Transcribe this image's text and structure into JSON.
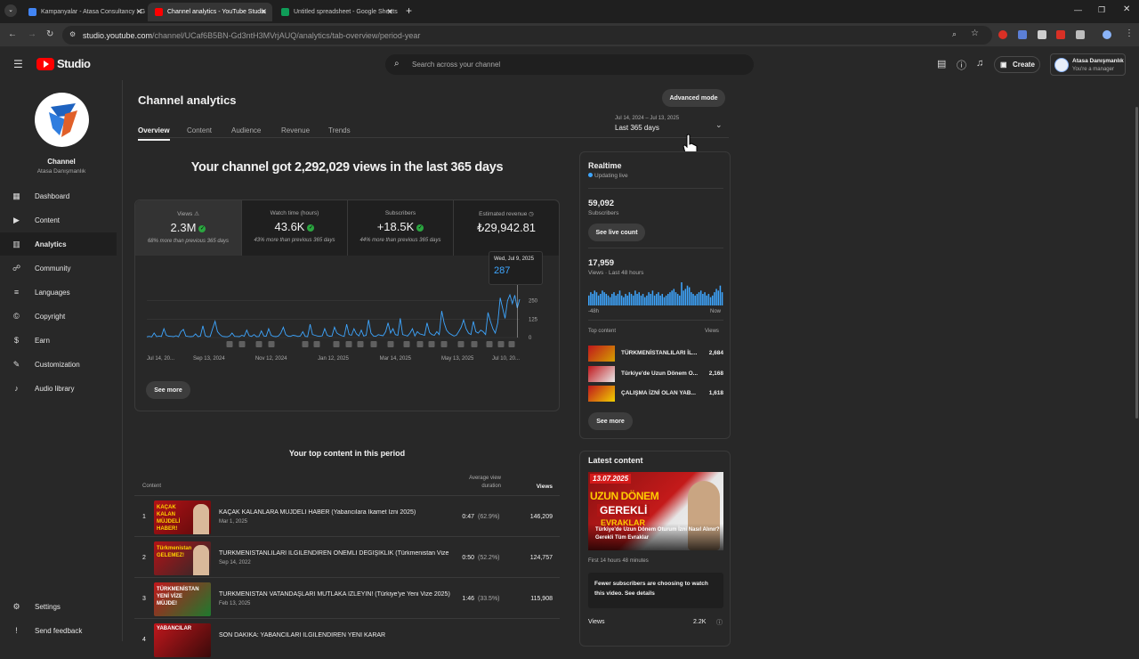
{
  "browser": {
    "tabs": [
      {
        "title": "Kampanyalar - Atasa Consultancy - G",
        "active": false,
        "color": "#4285f4"
      },
      {
        "title": "Channel analytics - YouTube Studio",
        "active": true,
        "color": "#ff0000"
      },
      {
        "title": "Untitled spreadsheet - Google Sheets",
        "active": false,
        "color": "#0f9d58"
      }
    ],
    "url_host": "studio.youtube.com",
    "url_path": "/channel/UCaf6B5BN-Gd3ntH3MVrjAUQ/analytics/tab-overview/period-year"
  },
  "header": {
    "logo_text": "Studio",
    "search_placeholder": "Search across your channel",
    "create_label": "Create",
    "account_name": "Atasa Danışmanlık",
    "account_role": "You're a manager"
  },
  "sidebar": {
    "channel_label": "Channel",
    "channel_name": "Atasa Danışmanlık",
    "items": [
      {
        "label": "Dashboard",
        "icon": "dashboard-icon"
      },
      {
        "label": "Content",
        "icon": "content-icon"
      },
      {
        "label": "Analytics",
        "icon": "analytics-icon",
        "active": true
      },
      {
        "label": "Community",
        "icon": "community-icon"
      },
      {
        "label": "Languages",
        "icon": "languages-icon"
      },
      {
        "label": "Copyright",
        "icon": "copyright-icon"
      },
      {
        "label": "Earn",
        "icon": "earn-icon"
      },
      {
        "label": "Customization",
        "icon": "customization-icon"
      },
      {
        "label": "Audio library",
        "icon": "audio-library-icon"
      }
    ],
    "settings_label": "Settings",
    "feedback_label": "Send feedback"
  },
  "page": {
    "title": "Channel analytics",
    "advanced_mode": "Advanced mode",
    "tabs": [
      "Overview",
      "Content",
      "Audience",
      "Revenue",
      "Trends"
    ],
    "active_tab": "Overview",
    "date_range": "Jul 14, 2024 – Jul 13, 2025",
    "date_preset": "Last 365 days",
    "headline": "Your channel got 2,292,029 views in the last 365 days"
  },
  "metrics": [
    {
      "label": "Views",
      "value": "2.3M",
      "compare": "68% more than previous 365 days"
    },
    {
      "label": "Watch time (hours)",
      "value": "43.6K",
      "compare": "43% more than previous 365 days"
    },
    {
      "label": "Subscribers",
      "value": "+18.5K",
      "compare": "44% more than previous 365 days"
    },
    {
      "label": "Estimated revenue",
      "value": "₺29,942.81",
      "compare": ""
    }
  ],
  "chart_data": {
    "type": "line",
    "x_ticks": [
      "Jul 14, 20...",
      "Sep 13, 2024",
      "Nov 12, 2024",
      "Jan 12, 2025",
      "Mar 14, 2025",
      "May 13, 2025",
      "Jul 10, 20..."
    ],
    "y_ticks": [
      "250",
      "125",
      "0"
    ],
    "ylim": [
      0,
      375
    ],
    "tooltip_date": "Wed, Jul 9, 2025",
    "tooltip_value": "287",
    "values": [
      5,
      8,
      4,
      30,
      6,
      10,
      7,
      60,
      15,
      9,
      8,
      6,
      12,
      5,
      40,
      55,
      10,
      7,
      6,
      8,
      25,
      6,
      9,
      80,
      12,
      5,
      7,
      60,
      110,
      40,
      20,
      8,
      6,
      5,
      10,
      30,
      8,
      7,
      6,
      15,
      9,
      50,
      12,
      8,
      20,
      6,
      7,
      45,
      10,
      9,
      60,
      15,
      8,
      6,
      10,
      30,
      70,
      20,
      9,
      8,
      15,
      12,
      7,
      10,
      40,
      8,
      6,
      90,
      20,
      15,
      10,
      8,
      12,
      60,
      15,
      9,
      10,
      70,
      30,
      20,
      12,
      8,
      90,
      20,
      15,
      60,
      25,
      10,
      50,
      10,
      15,
      120,
      30,
      10,
      8,
      20,
      15,
      12,
      40,
      100,
      30,
      60,
      20,
      15,
      130,
      20,
      15,
      10,
      30,
      60,
      10,
      40,
      25,
      20,
      15,
      100,
      35,
      20,
      15,
      40,
      20,
      180,
      100,
      50,
      30,
      20,
      10,
      15,
      40,
      70,
      120,
      60,
      30,
      20,
      110,
      40,
      30,
      50,
      40,
      20,
      170,
      110,
      60,
      30,
      100,
      270,
      200,
      130,
      250,
      290,
      230,
      287,
      200,
      260
    ],
    "video_marker_count": 20
  },
  "chart_see_more": "See more",
  "realtime": {
    "title": "Realtime",
    "updating": "Updating live",
    "subs_value": "59,092",
    "subs_label": "Subscribers",
    "see_live_count": "See live count",
    "views_value": "17,959",
    "views_label": "Views · Last 48 hours",
    "bar_left": "-48h",
    "bar_right": "Now",
    "bars": [
      6,
      8,
      7,
      9,
      8,
      6,
      7,
      9,
      8,
      7,
      6,
      5,
      7,
      8,
      6,
      7,
      9,
      6,
      5,
      7,
      6,
      8,
      7,
      6,
      9,
      7,
      8,
      6,
      7,
      5,
      6,
      8,
      7,
      9,
      6,
      7,
      8,
      6,
      7,
      5,
      6,
      7,
      8,
      9,
      10,
      8,
      7,
      6,
      14,
      9,
      10,
      12,
      11,
      8,
      7,
      6,
      7,
      8,
      9,
      7,
      8,
      6,
      7,
      5,
      6,
      8,
      10,
      9,
      12,
      8
    ],
    "top_content_label": "Top content",
    "views_col": "Views",
    "top_items": [
      {
        "title": "TÜRKMENİSTANLILARI İL...",
        "views": "2,684"
      },
      {
        "title": "Türkiye'de Uzun Dönem O...",
        "views": "2,168"
      },
      {
        "title": "ÇALIŞMA İZNİ OLAN YAB...",
        "views": "1,618"
      }
    ],
    "see_more": "See more"
  },
  "latest": {
    "title": "Latest content",
    "thumb_date": "13.07.2025",
    "thumb_line1": "UZUN DÖNEM",
    "thumb_line2": "GEREKLİ",
    "thumb_line3": "EVRAKLAR",
    "video_title": "Türkiye'de Uzun Dönem Oturum İzni Nasıl Alınır? Gerekli Tüm Evraklar",
    "since": "First 14 hours 48 minutes",
    "notice": "Fewer subscribers are choosing to watch this video. See details",
    "views_label": "Views",
    "views_value": "2.2K"
  },
  "top_content": {
    "title": "Your top content in this period",
    "col_content": "Content",
    "col_avd": "Average view duration",
    "col_views": "Views",
    "rows": [
      {
        "rank": "1",
        "title": "KAÇAK KALANLARA MÜJDELİ HABER (Yabancılara İkamet İzni 2025)",
        "date": "Mar 1, 2025",
        "avd": "0:47",
        "pct": "(62.9%)",
        "views": "146,209",
        "thumb_text": "KAÇAK KALAN MÜJDELİ HABER!"
      },
      {
        "rank": "2",
        "title": "TÜRKMENİSTANLILARI İLGİLENDİREN ÖNEMLİ DEĞİŞİKLİK (Türkmenistan Vize ...",
        "date": "Sep 14, 2022",
        "avd": "0:50",
        "pct": "(52.2%)",
        "views": "124,757",
        "thumb_text": "Türkmenistan GELEMEZ!"
      },
      {
        "rank": "3",
        "title": "TÜRKMENİSTAN VATANDAŞLARI MUTLAKA İZLEYİN! (Türkiye'ye Yeni Vize 2025)",
        "date": "Feb 13, 2025",
        "avd": "1:46",
        "pct": "(33.5%)",
        "views": "115,908",
        "thumb_text": "TÜRKMENİSTAN YENİ VİZE MÜJDE!"
      },
      {
        "rank": "4",
        "title": "SON DAKİKA: YABANCILARI İLGİLENDİREN YENİ KARAR",
        "date": "",
        "avd": "",
        "pct": "",
        "views": "",
        "thumb_text": "YABANCILAR"
      }
    ]
  }
}
